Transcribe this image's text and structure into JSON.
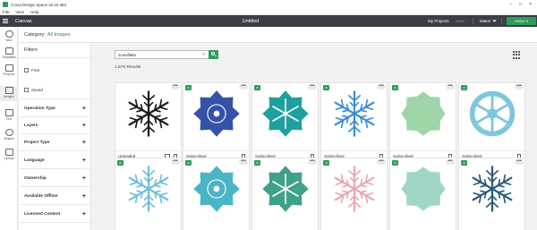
{
  "window": {
    "title": "Cricut Design Space  v6.15.384",
    "controls": [
      "–",
      "□",
      "×"
    ]
  },
  "menubar": [
    "File",
    "View",
    "Help"
  ],
  "header": {
    "brand": "Canvas",
    "doc_title": "Untitled",
    "my_projects": "My Projects",
    "save": "Save",
    "machine": "Maker",
    "make_it": "Make It"
  },
  "leftnav": [
    {
      "label": "New",
      "icon": "new-icon"
    },
    {
      "label": "Templates",
      "icon": "shirt-icon"
    },
    {
      "label": "Projects",
      "icon": "projects-icon"
    },
    {
      "label": "Images",
      "icon": "image-icon",
      "active": true
    },
    {
      "label": "Text",
      "icon": "text-icon"
    },
    {
      "label": "Shapes",
      "icon": "shapes-icon"
    },
    {
      "label": "Upload",
      "icon": "upload-icon"
    }
  ],
  "category": {
    "prefix": "Category:",
    "value": "All Images"
  },
  "filters": {
    "title": "Filters",
    "checks": [
      "Free",
      "Saved"
    ],
    "rows": [
      "Operation Type",
      "Layers",
      "Project Type",
      "Language",
      "Ownership",
      "Available Offline",
      "Licensed Content"
    ],
    "plus": "+"
  },
  "search": {
    "value": "snowflake",
    "clear": "×"
  },
  "results": "1,575 Results",
  "more_glyph": "•••",
  "badge_glyph": "a",
  "cards": [
    {
      "label": "Uploaded",
      "color": "#1a1a1a",
      "badge": false,
      "info": true
    },
    {
      "label": "Subscribed",
      "color": "#3552a8",
      "badge": true
    },
    {
      "label": "Subscribed",
      "color": "#1fa0a0",
      "badge": true
    },
    {
      "label": "Subscribed",
      "color": "#3b8ed8",
      "badge": true
    },
    {
      "label": "Subscribed",
      "color": "#9ed6a8",
      "badge": true
    },
    {
      "label": "Subscribed",
      "color": "#7fc6dd",
      "badge": true
    },
    {
      "label": "",
      "color": "#6fbfd8",
      "badge": true
    },
    {
      "label": "",
      "color": "#4ab5c7",
      "badge": true
    },
    {
      "label": "",
      "color": "#3fa08c",
      "badge": true
    },
    {
      "label": "",
      "color": "#e8a8b2",
      "badge": true
    },
    {
      "label": "",
      "color": "#9fd6c8",
      "badge": true
    },
    {
      "label": "",
      "color": "#2b5a7a",
      "badge": true
    }
  ]
}
